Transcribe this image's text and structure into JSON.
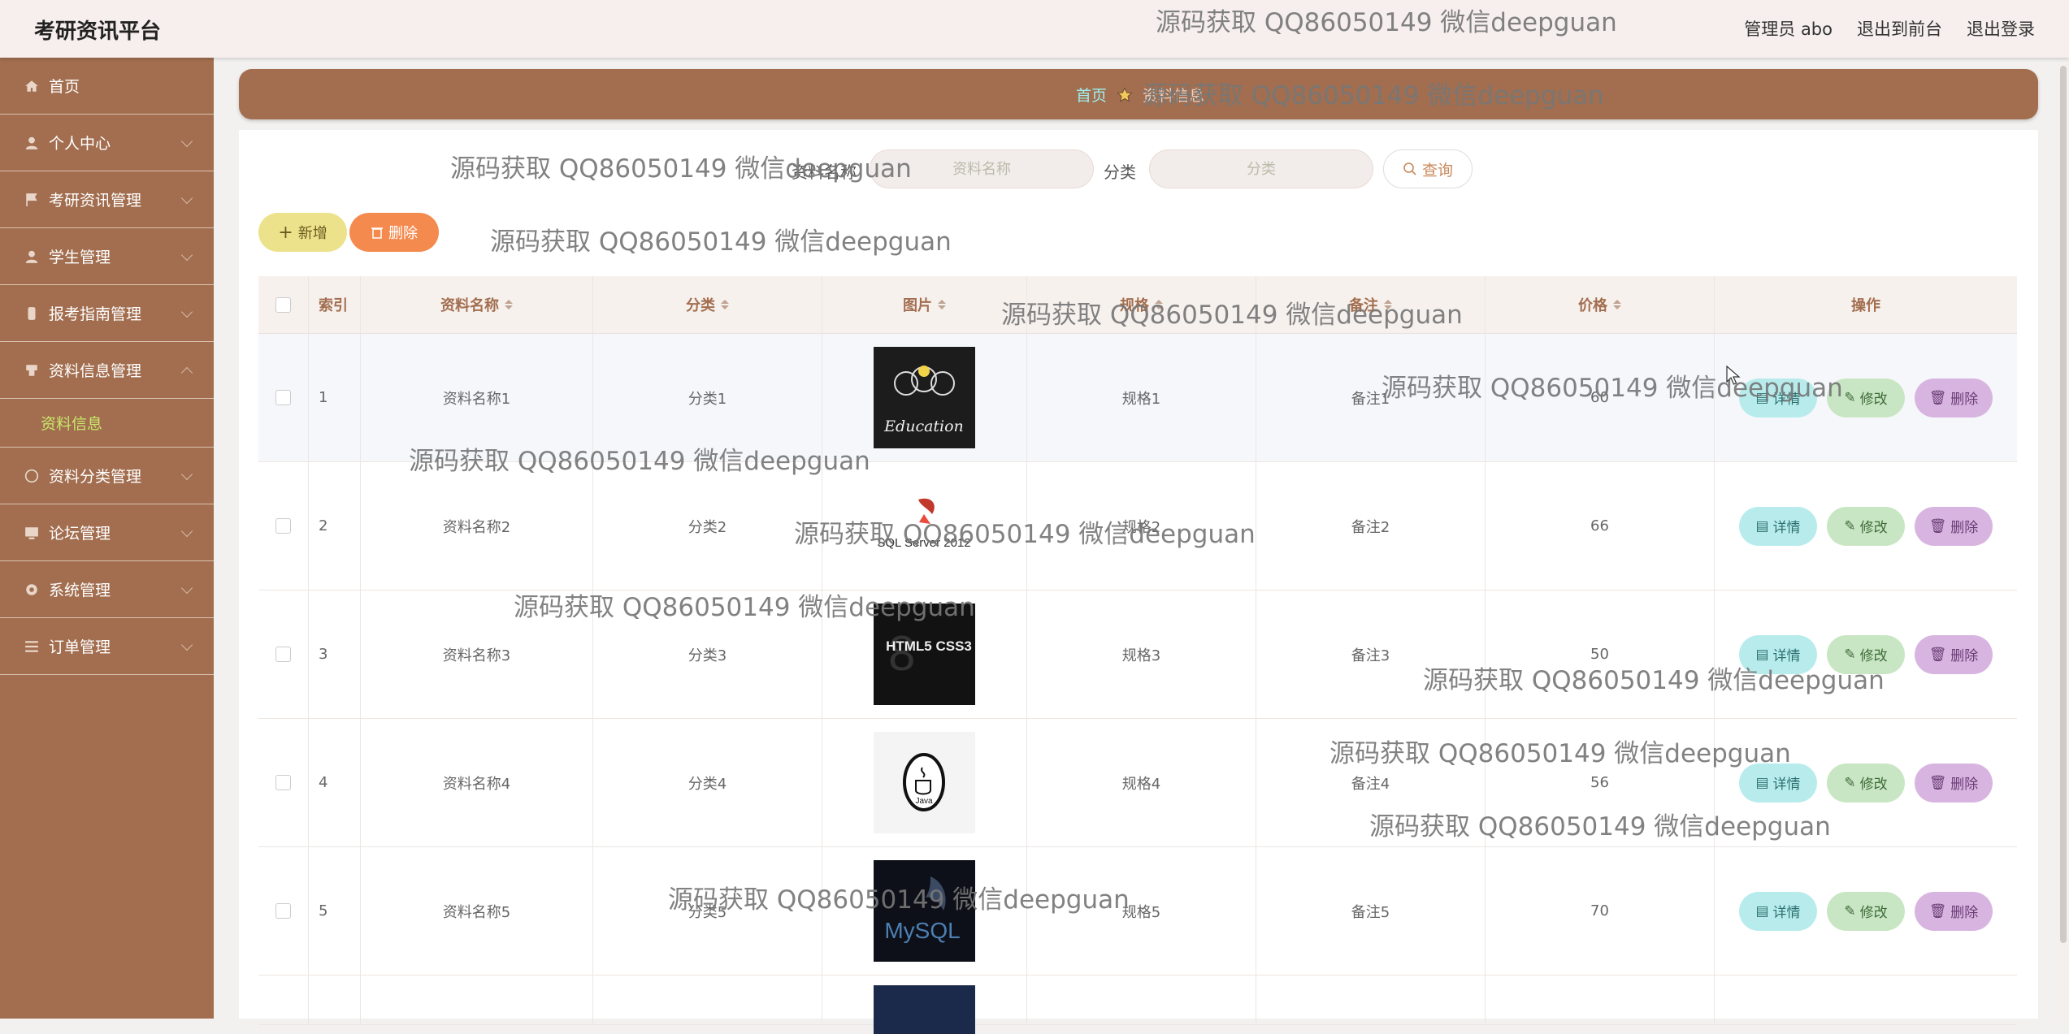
{
  "app_title": "考研资讯平台",
  "header": {
    "user": "管理员 abo",
    "front": "退出到前台",
    "logout": "退出登录"
  },
  "sidebar": {
    "items": [
      {
        "label": "首页",
        "icon": "home-icon"
      },
      {
        "label": "个人中心",
        "icon": "user-icon"
      },
      {
        "label": "考研资讯管理",
        "icon": "flag-icon"
      },
      {
        "label": "学生管理",
        "icon": "user-icon"
      },
      {
        "label": "报考指南管理",
        "icon": "phone-icon"
      },
      {
        "label": "资料信息管理",
        "icon": "doc-icon"
      }
    ],
    "sub_item": "资料信息",
    "items_after": [
      {
        "label": "资料分类管理",
        "icon": "clock-icon"
      },
      {
        "label": "论坛管理",
        "icon": "monitor-icon"
      },
      {
        "label": "系统管理",
        "icon": "gear-icon"
      },
      {
        "label": "订单管理",
        "icon": "list-icon"
      }
    ]
  },
  "breadcrumb": {
    "home": "首页",
    "current": "资料信息"
  },
  "search": {
    "name_label": "资料名称",
    "name_placeholder": "资料名称",
    "category_label": "分类",
    "category_placeholder": "分类",
    "query_label": "查询"
  },
  "actions": {
    "add": "新增",
    "delete": "删除"
  },
  "table": {
    "headers": [
      "索引",
      "资料名称",
      "分类",
      "图片",
      "规格",
      "备注",
      "价格",
      "操作"
    ],
    "rows": [
      {
        "index": "1",
        "name": "资料名称1",
        "category": "分类1",
        "image": "Education",
        "spec": "规格1",
        "note": "备注1",
        "price": "60"
      },
      {
        "index": "2",
        "name": "资料名称2",
        "category": "分类2",
        "image": "SQL Server 2012",
        "spec": "规格2",
        "note": "备注2",
        "price": "66"
      },
      {
        "index": "3",
        "name": "资料名称3",
        "category": "分类3",
        "image": "HTML5 CSS3",
        "spec": "规格3",
        "note": "备注3",
        "price": "50"
      },
      {
        "index": "4",
        "name": "资料名称4",
        "category": "分类4",
        "image": "Java",
        "spec": "规格4",
        "note": "备注4",
        "price": "56"
      },
      {
        "index": "5",
        "name": "资料名称5",
        "category": "分类5",
        "image": "MySQL",
        "spec": "规格5",
        "note": "备注5",
        "price": "70"
      }
    ],
    "op_detail": "详情",
    "op_edit": "修改",
    "op_delete": "删除"
  },
  "watermark": "源码获取 QQ86050149 微信deepguan"
}
